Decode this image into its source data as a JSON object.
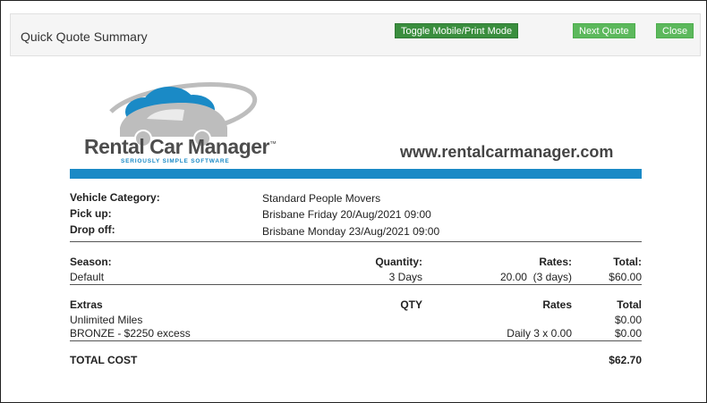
{
  "header": {
    "title": "Quick Quote Summary",
    "buttons": {
      "toggle": "Toggle Mobile/Print Mode",
      "next_quote": "Next Quote",
      "close": "Close"
    }
  },
  "branding": {
    "logo_name": "Rental Car Manager",
    "logo_tm": "™",
    "tagline": "SERIOUSLY SIMPLE SOFTWARE",
    "website": "www.rentalcarmanager.com",
    "accent_color": "#1a8ac6"
  },
  "details": {
    "vehicle_category_label": "Vehicle Category:",
    "vehicle_category": "Standard People Movers",
    "pickup_label": "Pick up:",
    "pickup": "Brisbane Friday 20/Aug/2021 09:00",
    "dropoff_label": "Drop off:",
    "dropoff": "Brisbane Monday 23/Aug/2021 09:00"
  },
  "season_table": {
    "headers": {
      "season": "Season:",
      "quantity": "Quantity:",
      "rates": "Rates:",
      "total": "Total:"
    },
    "row": {
      "season": "Default",
      "quantity": "3 Days",
      "rates": "20.00  (3 days)",
      "total": "$60.00"
    }
  },
  "extras_table": {
    "headers": {
      "extras": "Extras",
      "qty": "QTY",
      "rates": "Rates",
      "total": "Total"
    },
    "rows": [
      {
        "name": "Unlimited Miles",
        "rates": "",
        "total": "$0.00"
      },
      {
        "name": "BRONZE - $2250 excess",
        "rates": "Daily 3 x 0.00",
        "total": "$0.00"
      }
    ]
  },
  "totals": {
    "label": "TOTAL COST",
    "value": "$62.70"
  }
}
